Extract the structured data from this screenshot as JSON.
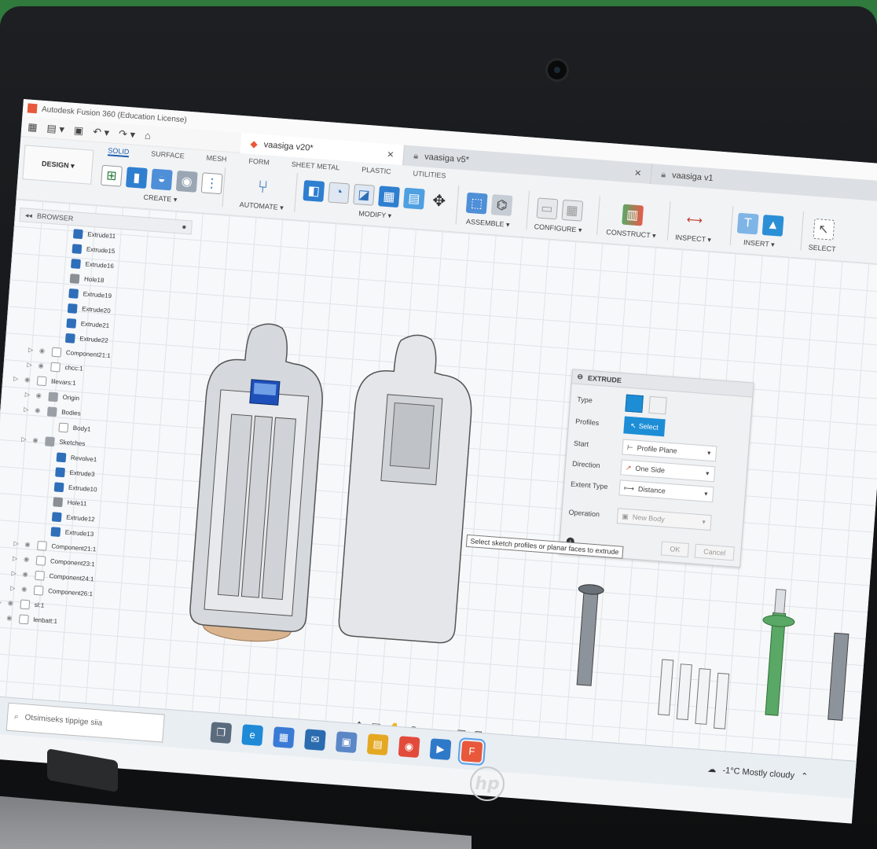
{
  "window": {
    "title": "Autodesk Fusion 360 (Education License)"
  },
  "document_tabs": [
    {
      "label": "vaasiga v20*",
      "active": true
    },
    {
      "label": "vaasiga v5*",
      "active": false
    },
    {
      "label": "vaasiga v1",
      "active": false
    }
  ],
  "toolbar": {
    "workspace_button": "DESIGN ▾",
    "workspace_tabs": [
      "SOLID",
      "SURFACE",
      "MESH",
      "FORM",
      "SHEET METAL",
      "PLASTIC",
      "UTILITIES"
    ],
    "groups": [
      "CREATE ▾",
      "AUTOMATE ▾",
      "MODIFY ▾",
      "ASSEMBLE ▾",
      "CONFIGURE ▾",
      "CONSTRUCT ▾",
      "INSPECT ▾",
      "INSERT ▾",
      "SELECT"
    ]
  },
  "browser": {
    "title": "BROWSER",
    "items": [
      {
        "label": "Extrude11",
        "icon": "feat",
        "depth": 2
      },
      {
        "label": "Extrude15",
        "icon": "feat",
        "depth": 2
      },
      {
        "label": "Extrude16",
        "icon": "feat",
        "depth": 2
      },
      {
        "label": "Hole18",
        "icon": "hole",
        "depth": 2
      },
      {
        "label": "Extrude19",
        "icon": "feat",
        "depth": 2
      },
      {
        "label": "Extrude20",
        "icon": "feat",
        "depth": 2
      },
      {
        "label": "Extrude21",
        "icon": "feat",
        "depth": 2
      },
      {
        "label": "Extrude22",
        "icon": "feat",
        "depth": 2
      },
      {
        "label": "Component21:1",
        "icon": "comp",
        "depth": 1
      },
      {
        "label": "chcc:1",
        "icon": "comp",
        "depth": 1
      },
      {
        "label": "lilevars:1",
        "icon": "comp",
        "depth": 0
      },
      {
        "label": "Origin",
        "icon": "folder",
        "depth": 1
      },
      {
        "label": "Bodies",
        "icon": "folder",
        "depth": 1
      },
      {
        "label": "Body1",
        "icon": "comp",
        "depth": 2
      },
      {
        "label": "Sketches",
        "icon": "folder",
        "depth": 1
      },
      {
        "label": "Revolve1",
        "icon": "feat",
        "depth": 2
      },
      {
        "label": "Extrude3",
        "icon": "feat",
        "depth": 2
      },
      {
        "label": "Extrude10",
        "icon": "feat",
        "depth": 2
      },
      {
        "label": "Hole11",
        "icon": "hole",
        "depth": 2
      },
      {
        "label": "Extrude12",
        "icon": "feat",
        "depth": 2
      },
      {
        "label": "Extrude13",
        "icon": "feat",
        "depth": 2
      },
      {
        "label": "Component21:1",
        "icon": "comp",
        "depth": 1
      },
      {
        "label": "Component23:1",
        "icon": "comp",
        "depth": 1
      },
      {
        "label": "Component24:1",
        "icon": "comp",
        "depth": 1
      },
      {
        "label": "Component26:1",
        "icon": "comp",
        "depth": 1
      },
      {
        "label": "sl:1",
        "icon": "comp",
        "depth": 0
      },
      {
        "label": "lenbatt:1",
        "icon": "comp",
        "depth": 0
      }
    ]
  },
  "extrude_dialog": {
    "title": "EXTRUDE",
    "rows": {
      "type": {
        "label": "Type"
      },
      "profiles": {
        "label": "Profiles",
        "value": "Select"
      },
      "start": {
        "label": "Start",
        "value": "Profile Plane"
      },
      "direction": {
        "label": "Direction",
        "value": "One Side"
      },
      "extent_type": {
        "label": "Extent Type",
        "value": "Distance"
      },
      "operation": {
        "label": "Operation",
        "value": "New Body"
      }
    },
    "ok_label": "OK",
    "cancel_label": "Cancel"
  },
  "tooltip": "Select sketch profiles or planar faces to extrude",
  "taskbar": {
    "search_placeholder": "Otsimiseks tippige siia",
    "weather": "-1°C  Mostly cloudy"
  },
  "colors": {
    "accent_blue": "#1d8ed6",
    "app_orange": "#e8583a",
    "part_grey": "#c9cdd2",
    "component_blue": "#1f4fb8",
    "base_tan": "#d9b48f",
    "green_part": "#5aa866"
  },
  "icons": [
    "grid-icon",
    "file-icon",
    "save-icon",
    "undo-icon",
    "redo-icon",
    "home-icon",
    "lock-icon",
    "close-icon",
    "eye-icon",
    "select-cursor-icon",
    "windows-start-icon",
    "search-icon",
    "weather-cloud-icon"
  ]
}
